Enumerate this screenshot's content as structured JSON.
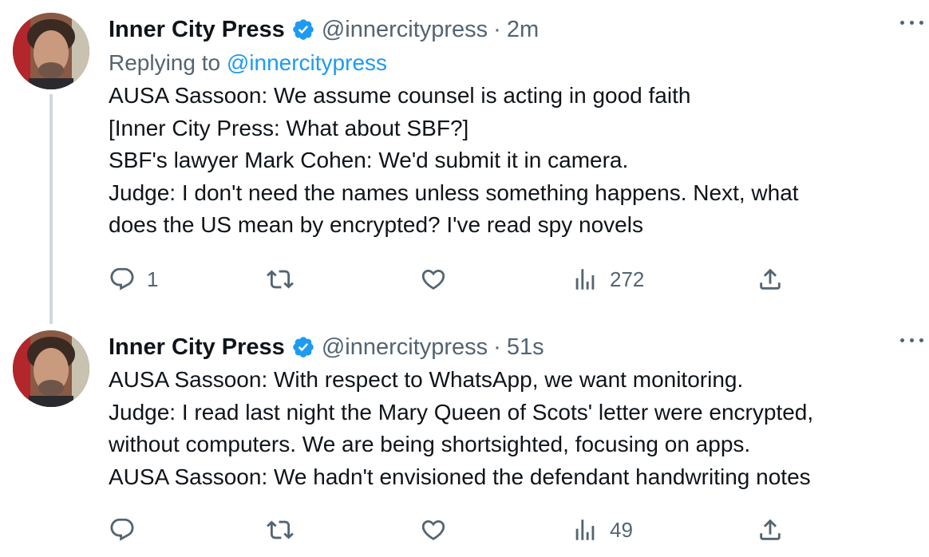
{
  "tweets": [
    {
      "name": "Inner City Press",
      "handle": "@innercitypress",
      "separator": "·",
      "time": "2m",
      "replying_prefix": "Replying to",
      "replying_handle": "@innercitypress",
      "lines": [
        "AUSA Sassoon: We assume counsel is acting in good faith",
        "[Inner City Press: What about SBF?]",
        "SBF's lawyer Mark Cohen: We'd submit it in camera.",
        "Judge: I don't need the names unless something happens. Next, what",
        "does the US mean by encrypted? I've read spy novels"
      ],
      "replies": "1",
      "retweets": "",
      "likes": "",
      "views": "272"
    },
    {
      "name": "Inner City Press",
      "handle": "@innercitypress",
      "separator": "·",
      "time": "51s",
      "lines": [
        "AUSA Sassoon: With respect to WhatsApp, we want monitoring.",
        "Judge: I read last night the Mary Queen of Scots' letter were encrypted,",
        "without computers. We are being shortsighted, focusing on apps.",
        "AUSA Sassoon: We hadn't envisioned the defendant handwriting notes"
      ],
      "replies": "",
      "retweets": "",
      "likes": "",
      "views": "49"
    }
  ],
  "colors": {
    "accent": "#1d9bf0",
    "secondary_text": "#536471",
    "primary_text": "#0f1419",
    "thread_line": "#cfd9de"
  },
  "icons": [
    "verified-badge-icon",
    "more-icon",
    "reply-icon",
    "retweet-icon",
    "like-icon",
    "views-icon",
    "share-icon"
  ]
}
